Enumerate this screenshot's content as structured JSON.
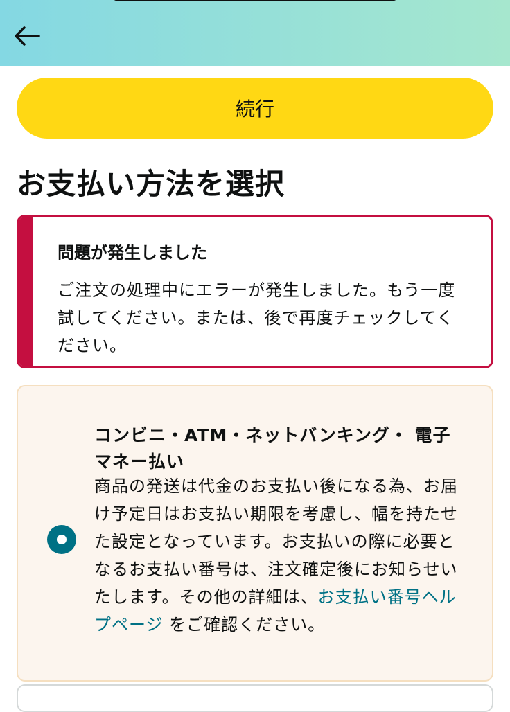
{
  "header": {
    "back_icon": "arrow-left-icon",
    "background_start": "#84d8e3",
    "background_end": "#a6e7ce"
  },
  "continue_button": {
    "label": "続行",
    "color": "#ffd814"
  },
  "page_title": "お支払い方法を選択",
  "error": {
    "title": "問題が発生しました",
    "message": "ご注文の処理中にエラーが発生しました。もう一度試してください。または、後で再度チェックしてください。",
    "accent_color": "#c40f40"
  },
  "payment_option": {
    "selected": true,
    "title": "コンビニ・ATM・ネットバンキング・ 電子マネー払い",
    "description_before_link": "商品の発送は代金のお支払い後になる為、お届け予定日はお支払い期限を考慮し、幅を持たせた設定となっています。お支払いの際に必要となるお支払い番号は、注文確定後にお知らせいたします。その他の詳細は、",
    "link_text": "お支払い番号ヘルプページ",
    "description_after_link": " をご確認ください。",
    "radio_color": "#007185",
    "card_background": "#fcf5ee"
  }
}
